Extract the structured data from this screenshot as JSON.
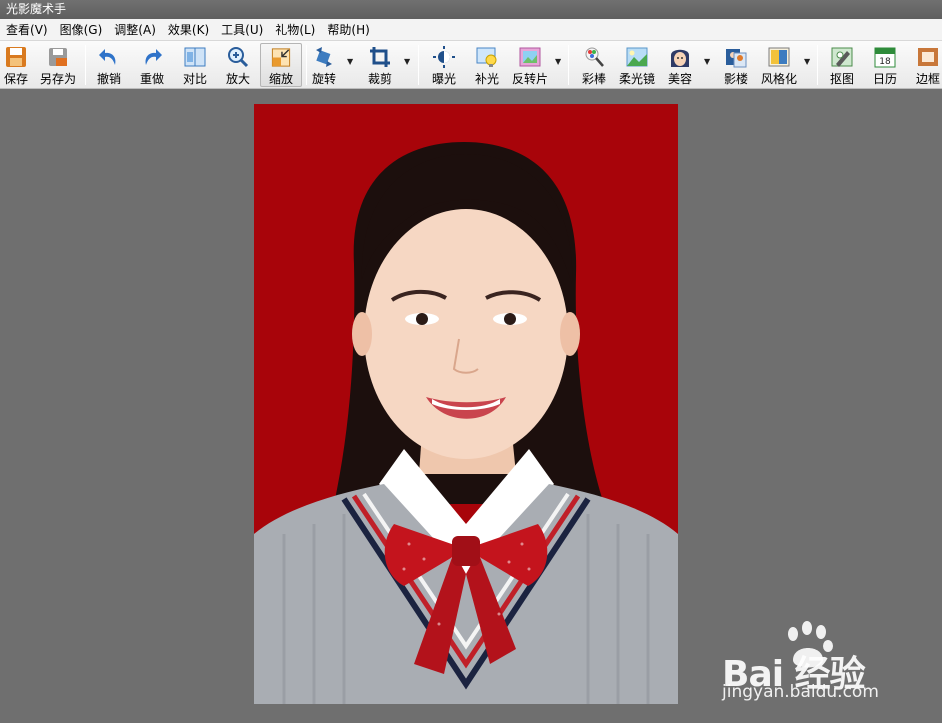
{
  "app": {
    "title": "光影魔术手"
  },
  "menu": [
    {
      "label": "查看",
      "key": "(V)"
    },
    {
      "label": "图像",
      "key": "(G)"
    },
    {
      "label": "调整",
      "key": "(A)"
    },
    {
      "label": "效果",
      "key": "(K)"
    },
    {
      "label": "工具",
      "key": "(U)"
    },
    {
      "label": "礼物",
      "key": "(L)"
    },
    {
      "label": "帮助",
      "key": "(H)"
    }
  ],
  "toolbar": {
    "save": "保存",
    "save_as": "另存为",
    "undo": "撤销",
    "redo": "重做",
    "compare": "对比",
    "zoom_in": "放大",
    "resize": "缩放",
    "rotate": "旋转",
    "crop": "裁剪",
    "exposure": "曝光",
    "fill_light": "补光",
    "negative": "反转片",
    "color_pen": "彩棒",
    "soft_focus": "柔光镜",
    "beauty": "美容",
    "studio": "影楼",
    "stylize": "风格化",
    "cutout": "抠图",
    "calendar": "日历",
    "calendar_day": "18",
    "border": "边框"
  },
  "watermark": {
    "brand": "Bai 经验",
    "url": "jingyan.baidu.com"
  },
  "colors": {
    "photo_background": "#a8040a",
    "workspace": "#6f6f6f"
  }
}
